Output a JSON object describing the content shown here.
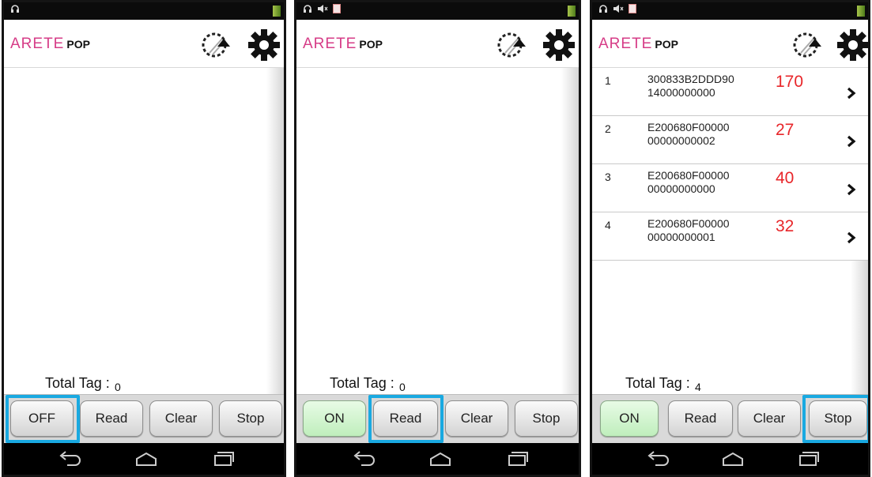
{
  "app": {
    "logo_text": "ARETE",
    "logo_suffix": "POP"
  },
  "screens": [
    {
      "total_label": "Total Tag :",
      "total_value": "0",
      "buttons": {
        "power": "OFF",
        "read": "Read",
        "clear": "Clear",
        "stop": "Stop"
      },
      "highlighted": "power-button",
      "tags": []
    },
    {
      "total_label": "Total Tag :",
      "total_value": "0",
      "buttons": {
        "power": "ON",
        "read": "Read",
        "clear": "Clear",
        "stop": "Stop"
      },
      "highlighted": "read-button",
      "tags": []
    },
    {
      "total_label": "Total Tag :",
      "total_value": "4",
      "buttons": {
        "power": "ON",
        "read": "Read",
        "clear": "Clear",
        "stop": "Stop"
      },
      "highlighted": "stop-button",
      "tags": [
        {
          "index": "1",
          "epc_line1": "300833B2DDD90",
          "epc_line2": "14000000000",
          "count": "170"
        },
        {
          "index": "2",
          "epc_line1": "E200680F00000",
          "epc_line2": "00000000002",
          "count": "27"
        },
        {
          "index": "3",
          "epc_line1": "E200680F00000",
          "epc_line2": "00000000000",
          "count": "40"
        },
        {
          "index": "4",
          "epc_line1": "E200680F00000",
          "epc_line2": "00000000001",
          "count": "32"
        }
      ]
    }
  ],
  "colors": {
    "highlight": "#19a9e1",
    "logo_pink": "#d63c87",
    "count_red": "#e8262a",
    "on_green": "#bfeebc"
  },
  "icons": {
    "status": [
      "headphones-icon",
      "mute-icon",
      "notification-icon",
      "signal-icon"
    ],
    "appbar": [
      "sync-icon",
      "gear-icon"
    ],
    "row": "chevron-right-icon",
    "nav": [
      "back-icon",
      "home-icon",
      "recent-apps-icon"
    ]
  }
}
